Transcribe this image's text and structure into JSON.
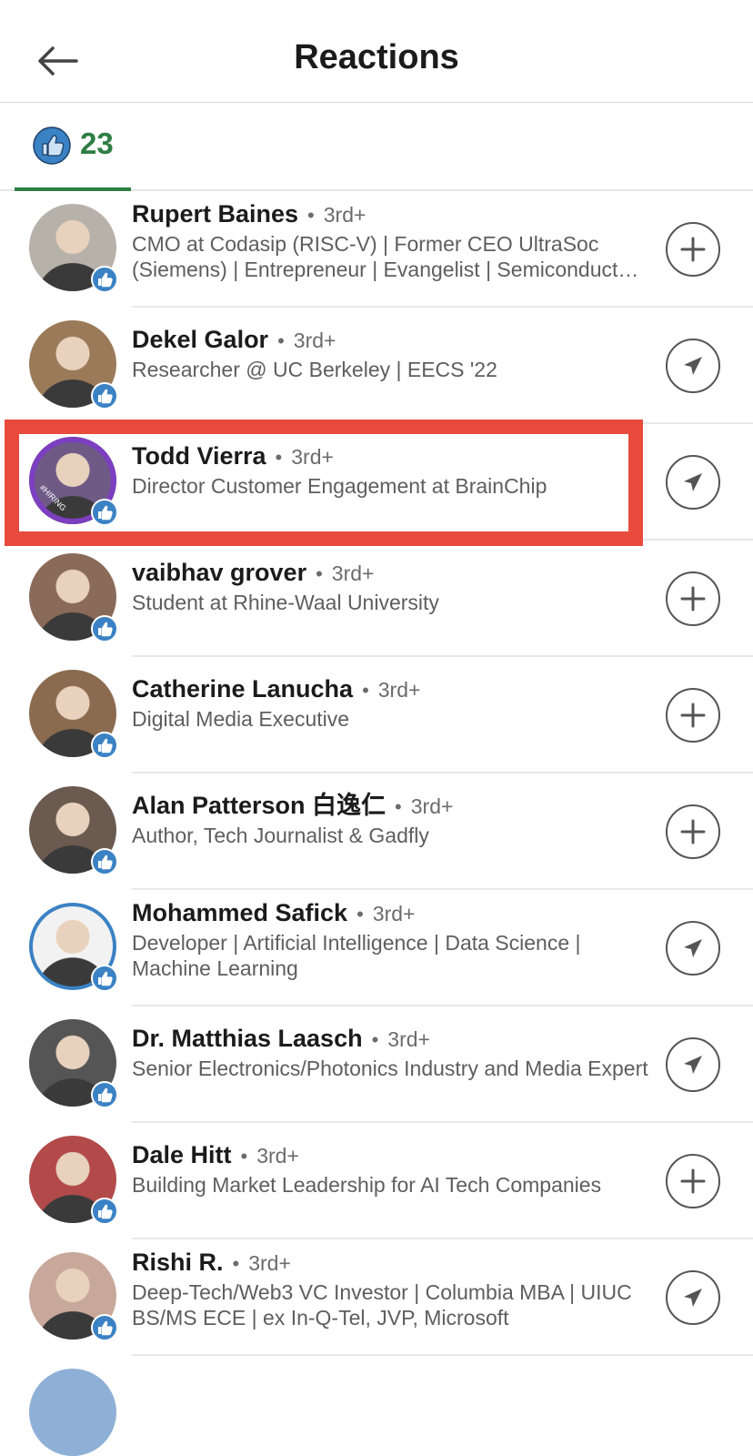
{
  "header": {
    "title": "Reactions",
    "back_icon": "arrow-left-icon"
  },
  "tabs": [
    {
      "icon": "like-icon",
      "count": "23"
    }
  ],
  "colors": {
    "accent": "#2e7d44",
    "like_blue": "#3b82c4",
    "highlight": "#e84a3c"
  },
  "people": [
    {
      "name": "Rupert Baines",
      "degree": "3rd+",
      "headline": "CMO at Codasip (RISC-V) | Former CEO UltraSoc (Siemens) | Entrepreneur | Evangelist | Semiconductor executive",
      "action": "connect",
      "avatar_color": "#b7b2a9"
    },
    {
      "name": "Dekel Galor",
      "degree": "3rd+",
      "headline": "Researcher @ UC Berkeley | EECS '22",
      "action": "message",
      "avatar_color": "#9b7a5a"
    },
    {
      "name": "Todd Vierra",
      "degree": "3rd+",
      "headline": "Director Customer Engagement at BrainChip",
      "action": "message",
      "avatar_color": "#6f5a86",
      "hiring": "#HIRING"
    },
    {
      "name": "vaibhav grover",
      "degree": "3rd+",
      "headline": "Student at Rhine-Waal University",
      "action": "connect",
      "avatar_color": "#8a6a58"
    },
    {
      "name": "Catherine Lanucha",
      "degree": "3rd+",
      "headline": "Digital Media Executive",
      "action": "connect",
      "avatar_color": "#8b6b4f"
    },
    {
      "name": "Alan Patterson 白逸仁",
      "degree": "3rd+",
      "headline": "Author, Tech Journalist & Gadfly",
      "action": "connect",
      "avatar_color": "#6b5a4f"
    },
    {
      "name": "Mohammed Safick",
      "degree": "3rd+",
      "headline": "Developer | Artificial Intelligence | Data Science | Machine Learning",
      "action": "message",
      "avatar_color": "#f2f2f2"
    },
    {
      "name": "Dr. Matthias Laasch",
      "degree": "3rd+",
      "headline": "Senior Electronics/Photonics Industry and Media Expert",
      "action": "message",
      "avatar_color": "#555555"
    },
    {
      "name": "Dale Hitt",
      "degree": "3rd+",
      "headline": "Building Market Leadership for AI Tech Companies",
      "action": "connect",
      "avatar_color": "#b24a4a"
    },
    {
      "name": "Rishi R.",
      "degree": "3rd+",
      "headline": "Deep-Tech/Web3 VC Investor | Columbia MBA | UIUC BS/MS ECE | ex In-Q-Tel, JVP, Microsoft",
      "action": "message",
      "avatar_color": "#c8a89a"
    }
  ]
}
